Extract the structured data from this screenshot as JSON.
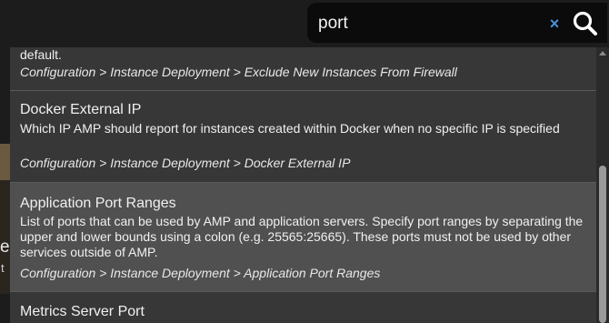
{
  "search": {
    "value": "port",
    "clear_symbol": "×"
  },
  "background": {
    "side_text_1": "e",
    "side_text_2": "t"
  },
  "results": [
    {
      "title": "",
      "description": "default.",
      "path": "Configuration > Instance Deployment > Exclude New Instances From Firewall"
    },
    {
      "title": "Docker External IP",
      "description": "Which IP AMP should report for instances created within Docker when no specific IP is specified",
      "path": "Configuration > Instance Deployment > Docker External IP"
    },
    {
      "title": "Application Port Ranges",
      "description": "List of ports that can be used by AMP and application servers. Specify port ranges by separating the upper and lower bounds using a colon (e.g. 25565:25665). These ports must not be used by other services outside of AMP.",
      "path": "Configuration > Instance Deployment > Application Port Ranges"
    },
    {
      "title": "Metrics Server Port",
      "description": "",
      "path": ""
    }
  ],
  "colors": {
    "accent_clear": "#4a90d9",
    "panel": "#373737",
    "highlight": "#505050"
  }
}
